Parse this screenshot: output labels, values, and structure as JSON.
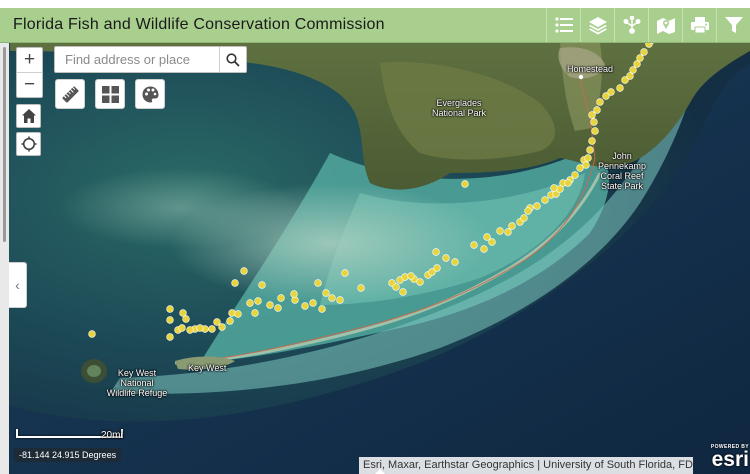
{
  "header": {
    "title": "Florida Fish and Wildlife Conservation Commission",
    "tools": [
      {
        "name": "legend",
        "icon": "list-icon"
      },
      {
        "name": "layers",
        "icon": "layers-icon"
      },
      {
        "name": "share",
        "icon": "share-icon"
      },
      {
        "name": "basemap",
        "icon": "basemap-icon"
      },
      {
        "name": "print",
        "icon": "print-icon"
      },
      {
        "name": "filter",
        "icon": "filter-icon"
      }
    ]
  },
  "search": {
    "placeholder": "Find address or place",
    "value": ""
  },
  "map": {
    "labels": {
      "homestead": "Homestead",
      "everglades_1": "Everglades",
      "everglades_2": "National Park",
      "pennekamp_1": "John",
      "pennekamp_2": "Pennekamp",
      "pennekamp_3": "Coral Reef",
      "pennekamp_4": "State Park",
      "keywest_nwr_1": "Key West",
      "keywest_nwr_2": "National",
      "keywest_nwr_3": "Wildlife Refuge",
      "keywest_city": "Key West"
    },
    "scale_label": "20mi",
    "coordinates": "-81.144 24.915 Degrees",
    "attribution": "Esri, Maxar, Earthstar Geographics | University of South Florida, FDEP, Esri, HE...",
    "powered_by": "POWERED BY",
    "esri_logo": "esri",
    "marker_color": "#e8d43c"
  }
}
